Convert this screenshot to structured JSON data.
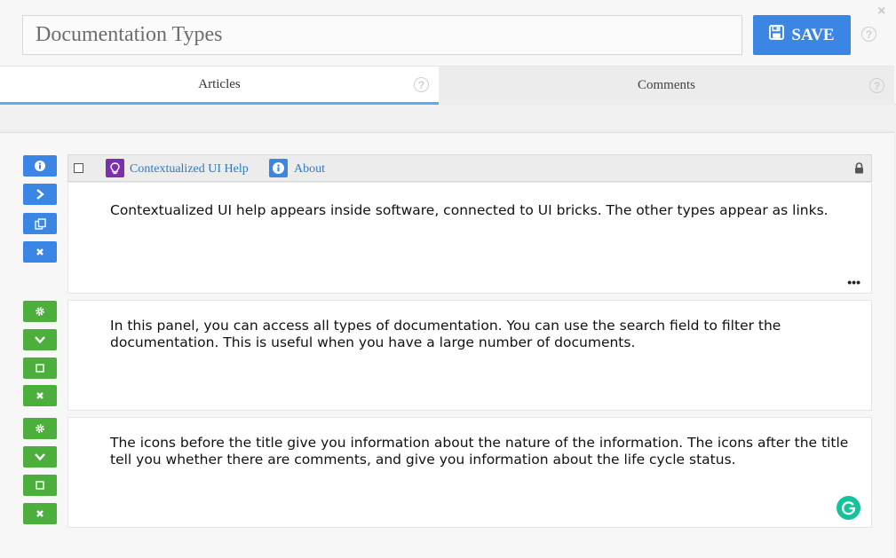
{
  "header": {
    "title_value": "Documentation Types",
    "save_label": "SAVE",
    "save_icon": "floppy-disk-icon",
    "help_icon": "question-circle-icon",
    "close_icon": "close-icon",
    "help_glyph": "?",
    "close_glyph": "×"
  },
  "tabs": [
    {
      "label": "Articles",
      "active": true
    },
    {
      "label": "Comments",
      "active": false
    }
  ],
  "cards": [
    {
      "header": {
        "links": [
          {
            "label": "Contextualized UI Help",
            "icon": "lightbulb-icon",
            "color": "#7b2fa8"
          },
          {
            "label": "About",
            "icon": "info-icon",
            "color": "#3b86e4"
          }
        ],
        "lock_icon": "lock-icon"
      },
      "text": "Contextualized UI help appears inside software, connected to UI bricks. The other types appear as links.",
      "more_label": "•••",
      "side_buttons": [
        "info-icon",
        "chevron-right-icon",
        "copy-icon",
        "close-icon"
      ]
    },
    {
      "text": "In this panel, you can access all types of documentation. You can use the search field to filter the documentation. This is useful when you have a large number of documents.",
      "side_buttons": [
        "gear-icon",
        "chevron-down-icon",
        "checkbox-icon",
        "close-icon"
      ]
    },
    {
      "text": "The icons before the title give you information about the nature of the information. The icons after the title tell you whether there are comments, and give you information about the life cycle status.",
      "side_buttons": [
        "gear-icon",
        "chevron-down-icon",
        "checkbox-icon",
        "close-icon"
      ]
    }
  ],
  "colors": {
    "accent_blue": "#3b86e4",
    "accent_green": "#4caf3c",
    "tab_underline": "#62a8f0",
    "grammarly": "#15c39a"
  }
}
